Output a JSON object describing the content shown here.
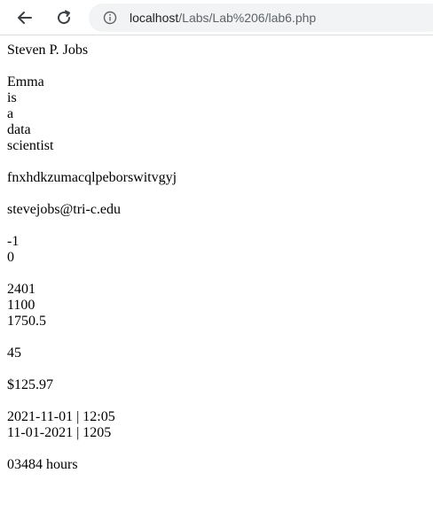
{
  "browser": {
    "url_host": "localhost",
    "url_path": "/Labs/Lab%206/lab6.php"
  },
  "content": {
    "name": "Steven P. Jobs",
    "sentence_words": [
      "Emma",
      "is",
      "a",
      "data",
      "scientist"
    ],
    "random_string": "fnxhdkzumacqlpeborswitvgyj",
    "email": "stevejobs@tri-c.edu",
    "compare_results": [
      "-1",
      "0"
    ],
    "numbers": [
      "2401",
      "1100",
      "1750.5"
    ],
    "single_number": "45",
    "price": "$125.97",
    "dates": [
      "2021-11-01 | 12:05",
      "11-01-2021 | 1205"
    ],
    "hours": "03484 hours"
  }
}
